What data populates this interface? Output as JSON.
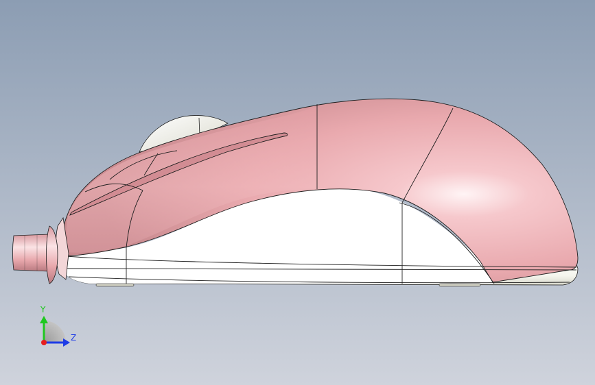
{
  "viewport": {
    "background_top": "#8c9db3",
    "background_bottom": "#cfd3dc"
  },
  "model": {
    "body_color": "#e9a9ae",
    "body_highlight": "#fbe6e8",
    "base_color": "#f4f4ec",
    "wheel_color": "#f2f2e8",
    "outline_color": "#1e1e1e"
  },
  "triad": {
    "y_label": "Y",
    "z_label": "Z",
    "y_color": "#1ec81e",
    "z_color": "#1e3ce6",
    "x_color": "#e61e1e"
  }
}
